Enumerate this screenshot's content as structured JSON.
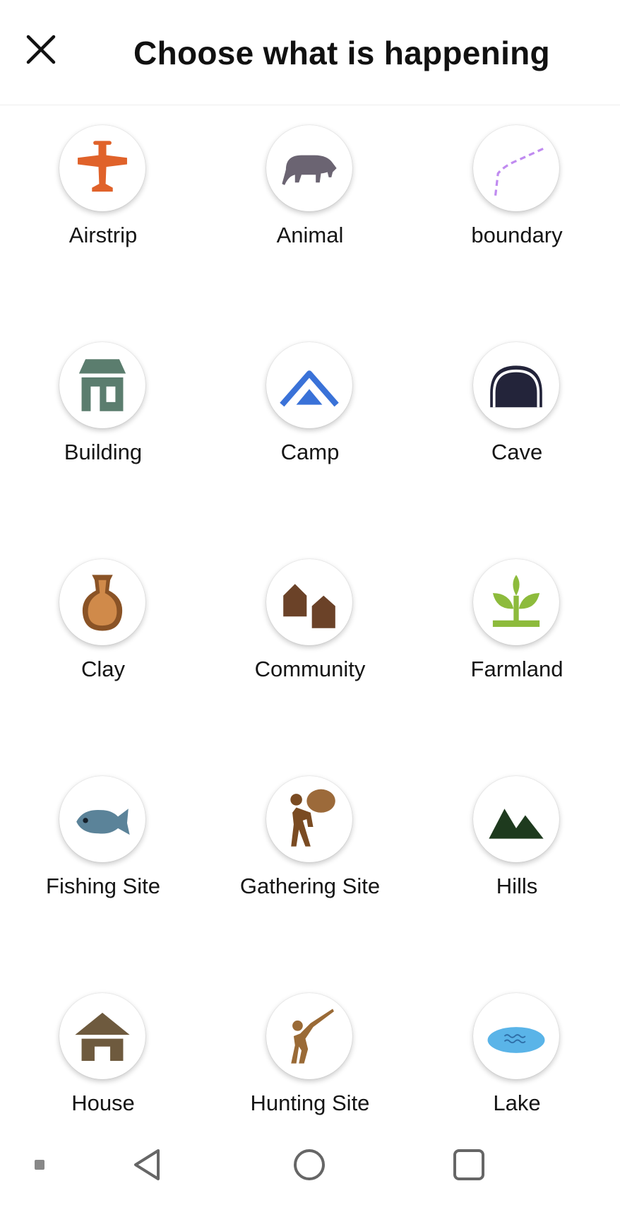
{
  "header": {
    "title": "Choose what is happening",
    "close_icon": "close-icon"
  },
  "categories": [
    {
      "label": "Airstrip",
      "icon": "airplane-icon",
      "color": "#E0622A"
    },
    {
      "label": "Animal",
      "icon": "boar-icon",
      "color": "#6B6472"
    },
    {
      "label": "boundary",
      "icon": "dashed-line-icon",
      "color": "#C08BF0"
    },
    {
      "label": "Building",
      "icon": "building-icon",
      "color": "#5B7D6E"
    },
    {
      "label": "Camp",
      "icon": "tent-icon",
      "color": "#3A72D8"
    },
    {
      "label": "Cave",
      "icon": "cave-icon",
      "color": "#23243A"
    },
    {
      "label": "Clay",
      "icon": "clay-pot-icon",
      "color": "#C87C3E"
    },
    {
      "label": "Community",
      "icon": "community-huts-icon",
      "color": "#6B4228"
    },
    {
      "label": "Farmland",
      "icon": "sprout-icon",
      "color": "#8DBB3C"
    },
    {
      "label": "Fishing Site",
      "icon": "fish-icon",
      "color": "#5B8399"
    },
    {
      "label": "Gathering Site",
      "icon": "gatherer-icon",
      "color": "#8A5A2E"
    },
    {
      "label": "Hills",
      "icon": "hills-icon",
      "color": "#1E3A1E"
    },
    {
      "label": "House",
      "icon": "house-icon",
      "color": "#6E5A3E"
    },
    {
      "label": "Hunting Site",
      "icon": "hunter-icon",
      "color": "#9A6A36"
    },
    {
      "label": "Lake",
      "icon": "lake-icon",
      "color": "#5AB4E8"
    }
  ],
  "navbar": {
    "items": [
      "nav-dot-icon",
      "back-triangle-icon",
      "home-circle-icon",
      "recents-square-icon"
    ]
  }
}
